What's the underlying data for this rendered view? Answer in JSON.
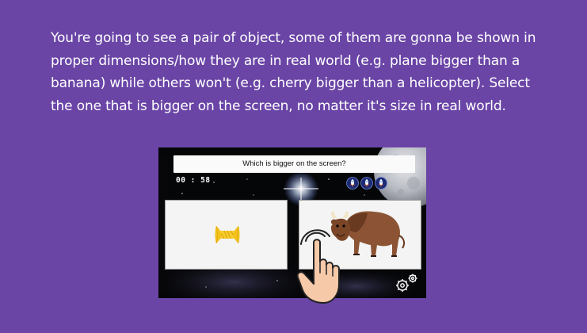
{
  "instruction": {
    "text": "You're going to see a pair of object, some of them are gonna be shown in proper dimensions/how they are in real world (e.g. plane bigger than a banana) while others won't (e.g. cherry bigger than a helicopter). Select the one that is bigger on the screen, no matter it's size in real world."
  },
  "game": {
    "question": "Which is bigger on the screen?",
    "timer": "00 : 58",
    "lives": [
      "rocket-life-icon",
      "rocket-life-icon",
      "rocket-life-icon"
    ],
    "left_option": "bow-tie-pasta-image",
    "right_option": "bison-image",
    "colors": {
      "background": "#6a45a6",
      "pasta": "#f4c21b",
      "bison": "#8c5434"
    }
  }
}
